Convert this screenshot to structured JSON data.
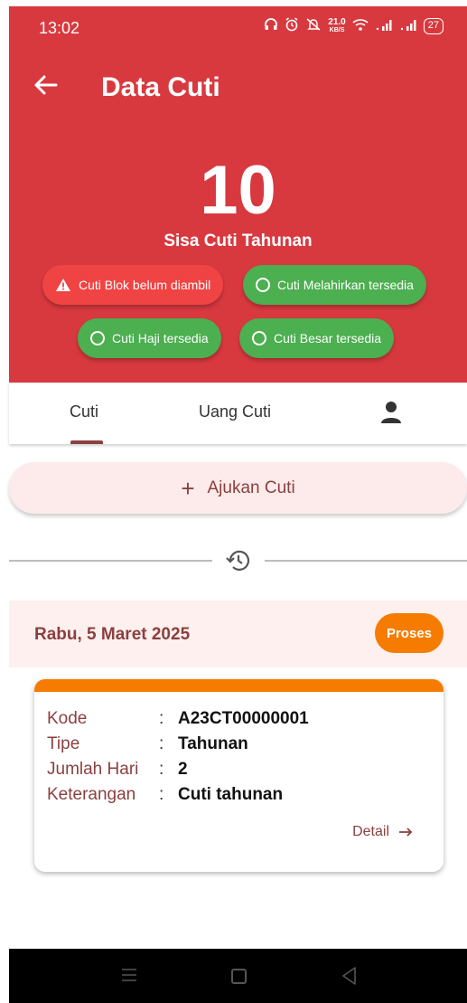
{
  "status": {
    "time": "13:02",
    "speed": "21.0",
    "speed_unit": "KB/S",
    "battery": "27"
  },
  "header": {
    "title": "Data Cuti",
    "count": "10",
    "count_label": "Sisa Cuti Tahunan"
  },
  "chips": [
    {
      "label": "Cuti Blok belum diambil",
      "color": "#ef4443"
    },
    {
      "label": "Cuti Melahirkan tersedia",
      "color": "#4caf50"
    },
    {
      "label": "Cuti Haji tersedia",
      "color": "#4caf50"
    },
    {
      "label": "Cuti Besar tersedia",
      "color": "#4caf50"
    }
  ],
  "tabs": [
    {
      "label": "Cuti"
    },
    {
      "label": "Uang Cuti"
    },
    {
      "icon": "person-icon"
    }
  ],
  "ajukan": {
    "label": "Ajukan Cuti"
  },
  "entry": {
    "date": "Rabu, 5 Maret 2025",
    "status": "Proses",
    "fields": [
      {
        "label": "Kode",
        "value": "A23CT00000001"
      },
      {
        "label": "Tipe",
        "value": "Tahunan"
      },
      {
        "label": "Jumlah Hari",
        "value": "2"
      },
      {
        "label": "Keterangan",
        "value": "Cuti tahunan"
      }
    ],
    "detail_label": "Detail"
  },
  "colors": {
    "header": "#d8393f",
    "accent": "#8b3f3f",
    "status_orange": "#f57c00"
  }
}
